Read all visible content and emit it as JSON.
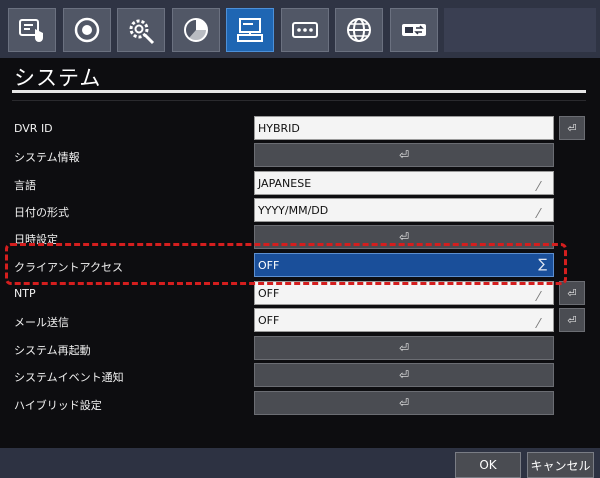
{
  "tabs": [
    {
      "icon": "touch-setup-icon",
      "active": false
    },
    {
      "icon": "record-disc-icon",
      "active": false
    },
    {
      "icon": "gear-wrench-icon",
      "active": false
    },
    {
      "icon": "pie-chart-icon",
      "active": false
    },
    {
      "icon": "computer-system-icon",
      "active": true
    },
    {
      "icon": "storage-card-icon",
      "active": false
    },
    {
      "icon": "network-globe-icon",
      "active": false
    },
    {
      "icon": "event-transfer-icon",
      "active": false
    }
  ],
  "title": "システム",
  "rows": {
    "dvr_id": {
      "label": "DVR ID",
      "value": "HYBRID"
    },
    "system_info": {
      "label": "システム情報"
    },
    "language": {
      "label": "言語",
      "value": "JAPANESE"
    },
    "date_format": {
      "label": "日付の形式",
      "value": "YYYY/MM/DD"
    },
    "datetime_settings": {
      "label": "日時設定"
    },
    "client_access": {
      "label": "クライアントアクセス",
      "value": "OFF"
    },
    "ntp": {
      "label": "NTP",
      "value": "OFF"
    },
    "mail": {
      "label": "メール送信",
      "value": "OFF"
    },
    "reboot": {
      "label": "システム再起動"
    },
    "event_notify": {
      "label": "システムイベント通知"
    },
    "hybrid": {
      "label": "ハイブリッド設定"
    }
  },
  "enter_glyph": "⏎",
  "sigma_glyph": "∑",
  "footer": {
    "ok": "OK",
    "cancel": "キャンセル"
  },
  "colors": {
    "active_tab": "#1f66b3",
    "highlight": "#d41e1e",
    "selected_field": "#1a4f9a"
  }
}
